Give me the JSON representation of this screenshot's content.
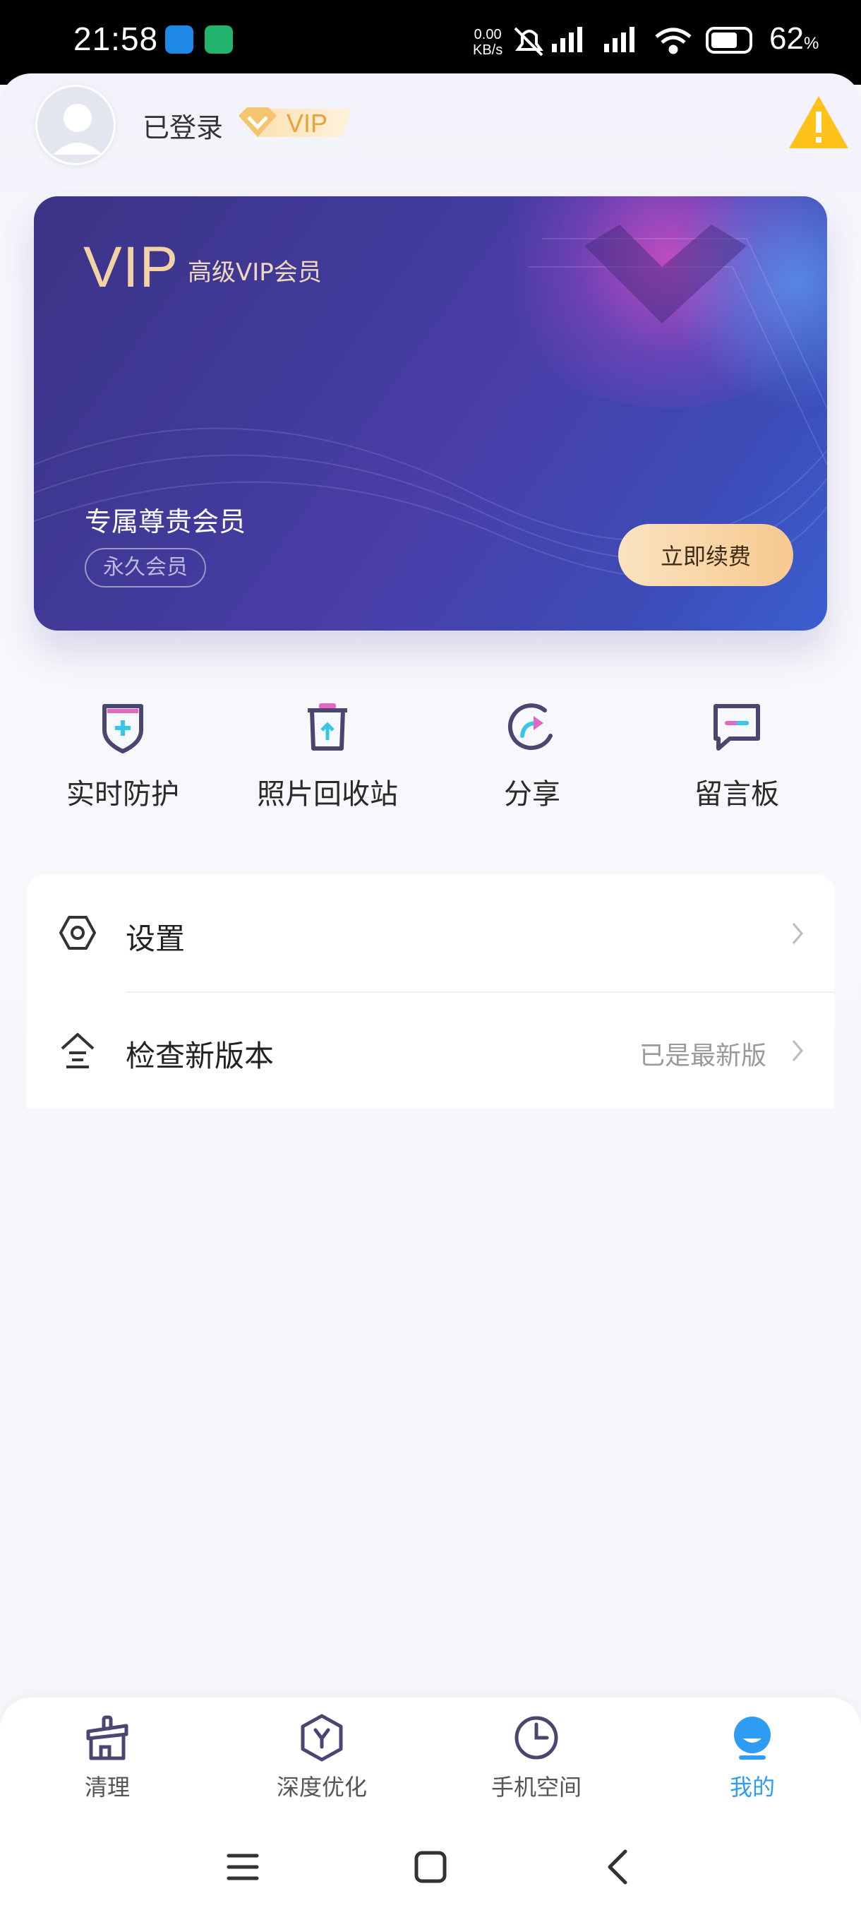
{
  "status_bar": {
    "time": "21:58",
    "net_speed_value": "0.00",
    "net_speed_unit": "KB/s",
    "battery_percent": "62",
    "battery_unit": "%",
    "icons": [
      "app-icon-bird",
      "app-icon-green",
      "mute-icon",
      "signal-icon",
      "signal-icon",
      "wifi-icon",
      "battery-icon"
    ]
  },
  "profile": {
    "login_status": "已登录",
    "vip_badge": "VIP",
    "warning_icon": "warning-icon"
  },
  "vip_card": {
    "title": "VIP",
    "subtitle": "高级VIP会员",
    "member_label": "专属尊贵会员",
    "membership_type": "永久会员",
    "renew_button": "立即续费"
  },
  "quick_actions": [
    {
      "label": "实时防护",
      "icon": "shield-icon"
    },
    {
      "label": "照片回收站",
      "icon": "trash-icon"
    },
    {
      "label": "分享",
      "icon": "share-icon"
    },
    {
      "label": "留言板",
      "icon": "message-icon"
    }
  ],
  "settings_list": [
    {
      "label": "设置",
      "value": "",
      "icon": "hexagon-settings-icon"
    },
    {
      "label": "检查新版本",
      "value": "已是最新版",
      "icon": "update-icon"
    }
  ],
  "bottom_nav": {
    "active": "我的",
    "items": [
      {
        "label": "清理",
        "icon": "clean-icon"
      },
      {
        "label": "深度优化",
        "icon": "optimize-icon"
      },
      {
        "label": "手机空间",
        "icon": "storage-icon"
      },
      {
        "label": "我的",
        "icon": "profile-icon"
      }
    ]
  },
  "system_nav": [
    "menu-icon",
    "home-icon",
    "back-icon"
  ],
  "colors": {
    "accent_blue": "#2e9cf2",
    "vip_gold": "#e8a23a",
    "card_start": "#3c3486",
    "card_end": "#3b5fd0"
  }
}
